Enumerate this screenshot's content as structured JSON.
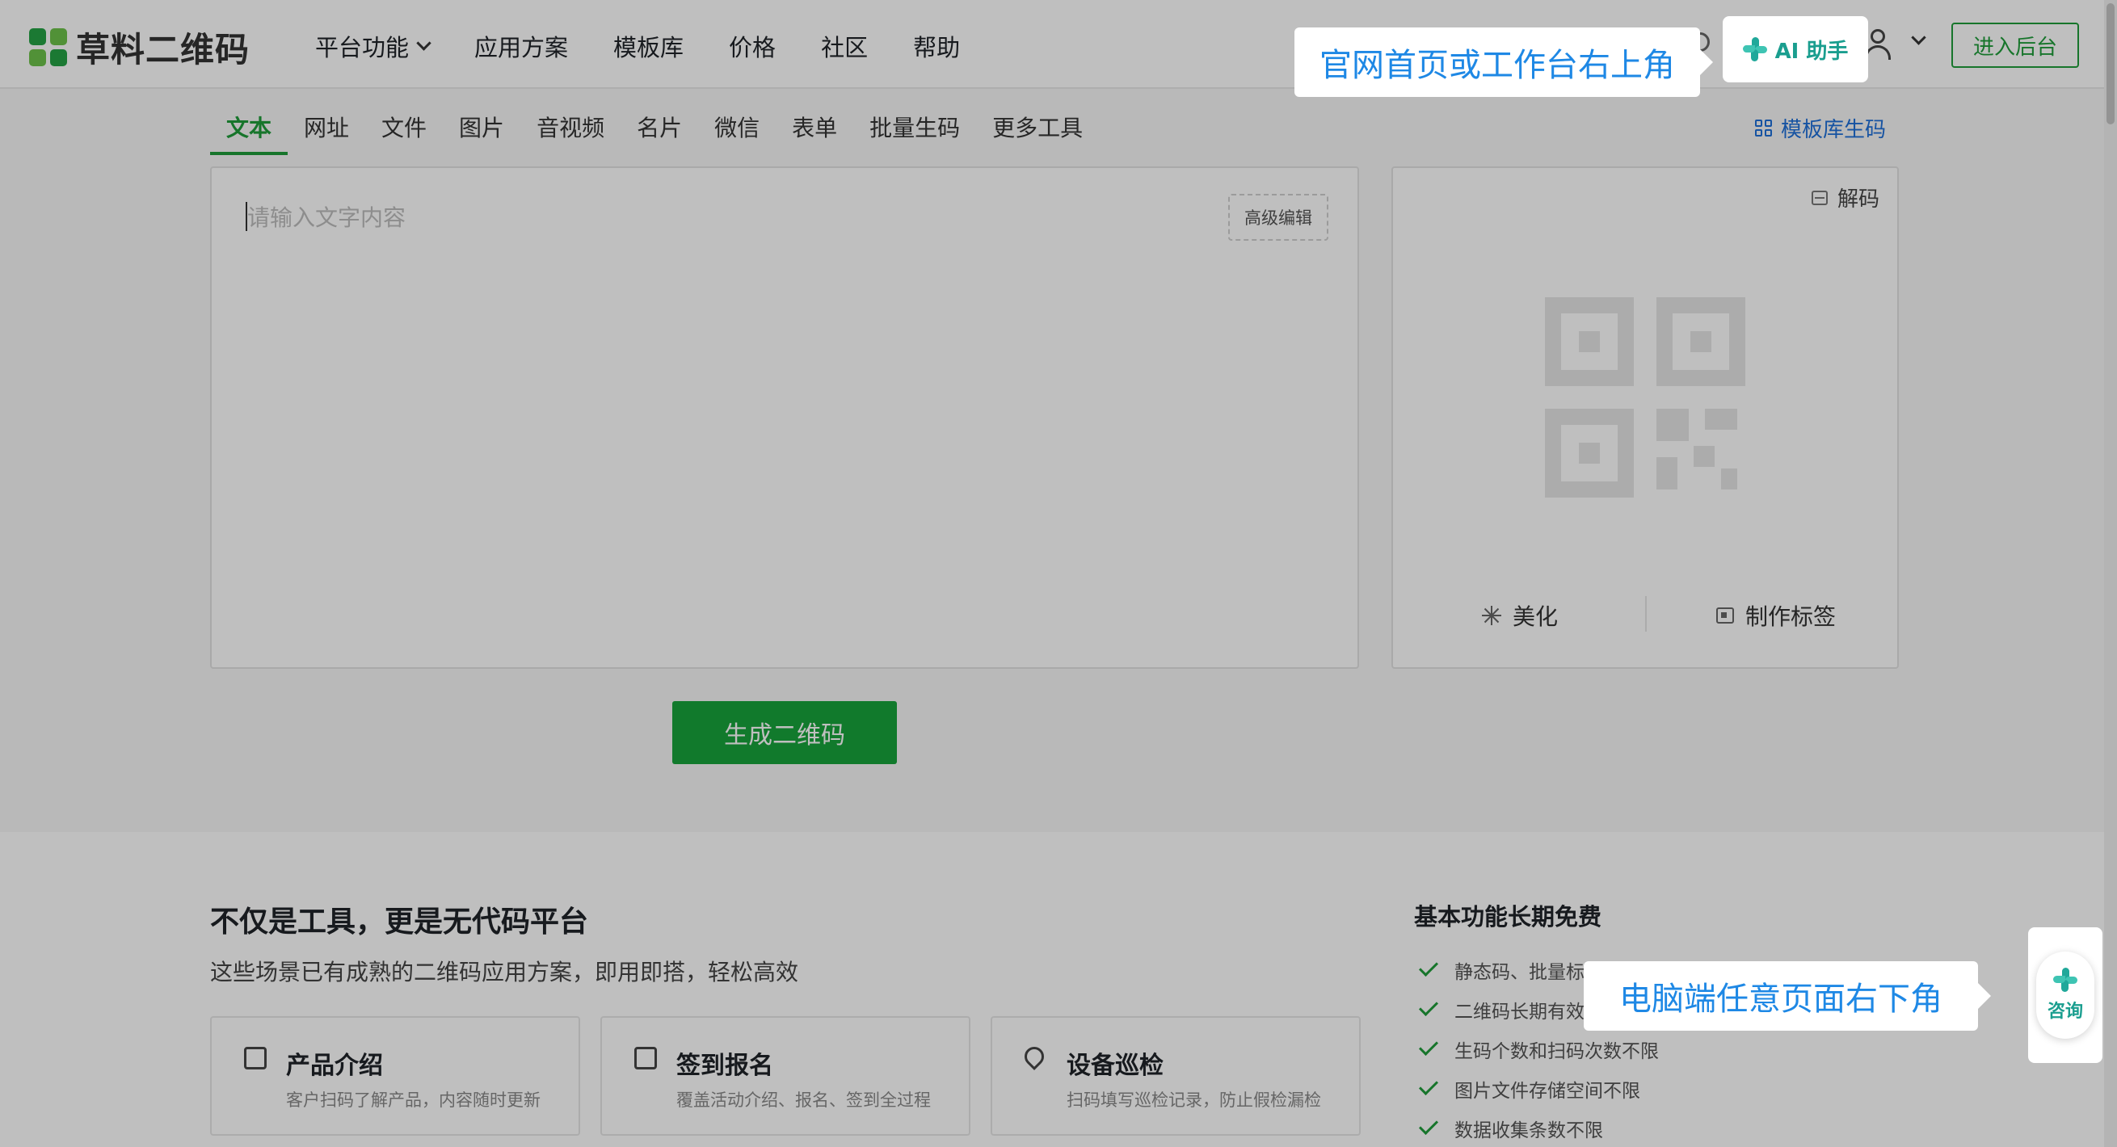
{
  "header": {
    "logo_text": "草料二维码",
    "nav": [
      "平台功能",
      "应用方案",
      "模板库",
      "价格",
      "社区",
      "帮助"
    ],
    "ai_assistant": "AI 助手",
    "enter_backend": "进入后台"
  },
  "callouts": {
    "top": "官网首页或工作台右上角",
    "bottom": "电脑端任意页面右下角"
  },
  "tabs": {
    "items": [
      "文本",
      "网址",
      "文件",
      "图片",
      "音视频",
      "名片",
      "微信",
      "表单",
      "批量生码",
      "更多工具"
    ],
    "active": "文本",
    "template_link": "模板库生码"
  },
  "editor": {
    "placeholder": "请输入文字内容",
    "advanced_edit": "高级编辑"
  },
  "preview": {
    "decode": "解码",
    "beautify": "美化",
    "make_label": "制作标签"
  },
  "generate_button": "生成二维码",
  "lower": {
    "title": "不仅是工具，更是无代码平台",
    "subtitle": "这些场景已有成熟的二维码应用方案，即用即搭，轻松高效",
    "cards": [
      {
        "title": "产品介绍",
        "desc": "客户扫码了解产品，内容随时更新"
      },
      {
        "title": "签到报名",
        "desc": "覆盖活动介绍、报名、签到全过程"
      },
      {
        "title": "设备巡检",
        "desc": "扫码填写巡检记录，防止假检漏检"
      }
    ],
    "free_title": "基本功能长期免费",
    "features": [
      "静态码、批量标签等工具完全免费",
      "二维码长期有效",
      "生码个数和扫码次数不限",
      "图片文件存储空间不限",
      "数据收集条数不限"
    ]
  },
  "consult": {
    "label": "咨询"
  },
  "colors": {
    "brand_green": "#1f9d3a",
    "callout_blue": "#1e88e5",
    "ai_teal": "#1a9e8f"
  }
}
